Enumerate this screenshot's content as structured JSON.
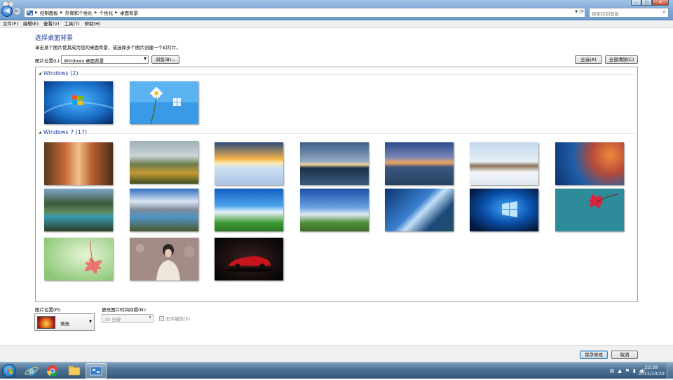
{
  "address": {
    "segments": [
      "控制面板",
      "外观和个性化",
      "个性化",
      "桌面背景"
    ],
    "search_placeholder": "搜索控制面板"
  },
  "menu": [
    "文件(F)",
    "编辑(E)",
    "查看(V)",
    "工具(T)",
    "帮助(H)"
  ],
  "page": {
    "heading": "选择桌面背景",
    "subtitle": "单击某个图片使其成为您的桌面背景，或选择多个图片创建一个幻灯片。",
    "location_label": "图片位置(L):",
    "location_value": "Windows 桌面背景",
    "browse_label": "浏览(B)...",
    "select_all_label": "全选(A)",
    "clear_all_label": "全部清除(C)"
  },
  "gallery": {
    "groups": [
      {
        "label": "Windows (2)",
        "thumbs": [
          "windows-7-logo",
          "daisy-windows-logo"
        ]
      },
      {
        "label": "Windows 7 (17)",
        "thumbs": [
          "autumn-forest-path",
          "foggy-autumn-valley",
          "snow-sunset-footprints",
          "lake-sunset",
          "sea-sunset-clouds",
          "snowy-tree-road",
          "blue-orange-blur",
          "mountain-lake-green",
          "mountain-lake-clouds",
          "blue-sky-meadow",
          "wind-turbine-road",
          "blue-light-streaks",
          "windows-10-logo",
          "red-flower-teal",
          "pink-flower-green",
          "woman-headphones",
          "red-sports-car"
        ]
      }
    ]
  },
  "bottom": {
    "position_label": "图片位置(P):",
    "position_value": "填充",
    "interval_label": "更改图片时间间隔(N):",
    "interval_value": "30 分钟",
    "shuffle_label": "无序播放(S)"
  },
  "footer": {
    "save_label": "保存修改",
    "cancel_label": "取消"
  },
  "taskbar": {
    "time": "22:58",
    "date": "2015/10/29"
  }
}
